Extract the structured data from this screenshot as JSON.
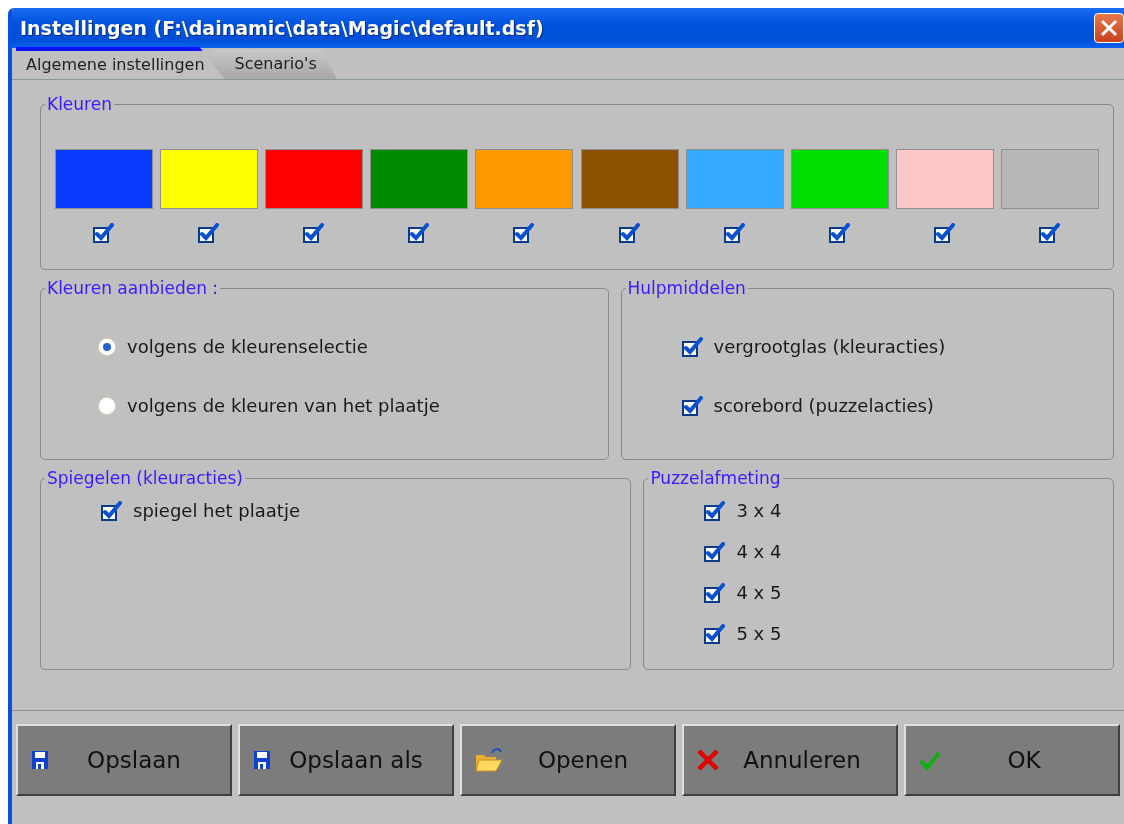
{
  "window": {
    "title": "Instellingen (F:\\dainamic\\data\\Magic\\default.dsf)"
  },
  "tabs": [
    {
      "label": "Algemene instellingen",
      "selected": true
    },
    {
      "label": "Scenario's",
      "selected": false
    }
  ],
  "colors": {
    "title": "Kleuren",
    "swatches": [
      {
        "color": "#0a3cff",
        "checked": true
      },
      {
        "color": "#ffff00",
        "checked": true
      },
      {
        "color": "#ff0000",
        "checked": true
      },
      {
        "color": "#008a00",
        "checked": true
      },
      {
        "color": "#ff9900",
        "checked": true
      },
      {
        "color": "#8b5200",
        "checked": true
      },
      {
        "color": "#33aaff",
        "checked": true
      },
      {
        "color": "#00e000",
        "checked": true
      },
      {
        "color": "#ffc8c8",
        "checked": true
      },
      {
        "color": "#b8b8b8",
        "checked": true
      }
    ]
  },
  "offer_colors": {
    "title": "Kleuren aanbieden :",
    "options": [
      {
        "label": "volgens de kleurenselectie",
        "selected": true
      },
      {
        "label": "volgens de kleuren van het plaatje",
        "selected": false
      }
    ]
  },
  "aids": {
    "title": "Hulpmiddelen",
    "options": [
      {
        "label": "vergrootglas (kleuracties)",
        "checked": true
      },
      {
        "label": "scorebord (puzzelacties)",
        "checked": true
      }
    ]
  },
  "mirror": {
    "title": "Spiegelen (kleuracties)",
    "options": [
      {
        "label": "spiegel het plaatje",
        "checked": true
      }
    ]
  },
  "puzzle_size": {
    "title": "Puzzelafmeting",
    "options": [
      {
        "label": "3 x 4",
        "checked": true
      },
      {
        "label": "4 x 4",
        "checked": true
      },
      {
        "label": "4 x 5",
        "checked": true
      },
      {
        "label": "5 x 5",
        "checked": true
      }
    ]
  },
  "buttons": [
    {
      "label": "Opslaan",
      "kind": "save"
    },
    {
      "label": "Opslaan als",
      "kind": "save"
    },
    {
      "label": "Openen",
      "kind": "open"
    },
    {
      "label": "Annuleren",
      "kind": "cancel"
    },
    {
      "label": "OK",
      "kind": "ok"
    }
  ]
}
